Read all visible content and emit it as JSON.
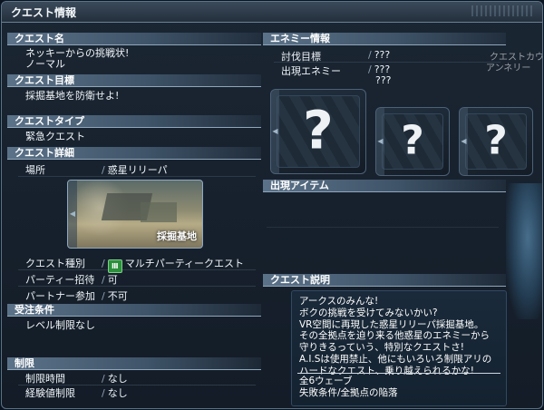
{
  "window": {
    "title": "クエスト情報"
  },
  "left": {
    "quest_name": {
      "header": "クエスト名",
      "name": "ネッキーからの挑戦状!",
      "difficulty": "ノーマル"
    },
    "quest_goal": {
      "header": "クエスト目標",
      "text": "採掘基地を防衛せよ!"
    },
    "quest_type": {
      "header": "クエストタイプ",
      "text": "緊急クエスト"
    },
    "quest_detail": {
      "header": "クエスト詳細",
      "location_label": "場所",
      "location_value": "惑星リリーパ",
      "thumbnail_caption": "採掘基地",
      "type_label": "クエスト種別",
      "type_value": "マルチパーティークエスト",
      "type_badge": "Ⅲ",
      "party_label": "パーティー招待",
      "party_value": "可",
      "partner_label": "パートナー参加",
      "partner_value": "不可"
    },
    "entry_conditions": {
      "header": "受注条件",
      "text": "レベル制限なし"
    },
    "limits": {
      "header": "制限",
      "time_label": "制限時間",
      "time_value": "なし",
      "exp_label": "経験値制限",
      "exp_value": "なし"
    }
  },
  "right": {
    "enemy_info": {
      "header": "エネミー情報",
      "target_label": "討伐目標",
      "target_value": "???",
      "appear_label": "出現エネミー",
      "appear_value1": "???",
      "appear_value2": "???",
      "unknown_mark": "?"
    },
    "items": {
      "header": "出現アイテム"
    },
    "description": {
      "header": "クエスト説明",
      "lines": [
        "アークスのみんな!",
        "ボクの挑戦を受けてみないかい?",
        "VR空間に再現した惑星リリーパ採掘基地。",
        "その全拠点を迫り来る他惑星のエネミーから",
        "守りきるっていう、特別なクエストさ!",
        "A.I.Sは使用禁止、他にもいろいろ制限アリの",
        "ハードなクエスト、乗り越えられるかな!"
      ],
      "footer1": "全6ウェーブ",
      "footer2": "失敗条件/全拠点の陥落"
    },
    "ghost_text1": "クエストカウ",
    "ghost_text2": "アンネリー"
  },
  "colors": {
    "header_bar": "#4f667c",
    "panel_bg": "#131c27",
    "desc_bg": "#182838"
  }
}
